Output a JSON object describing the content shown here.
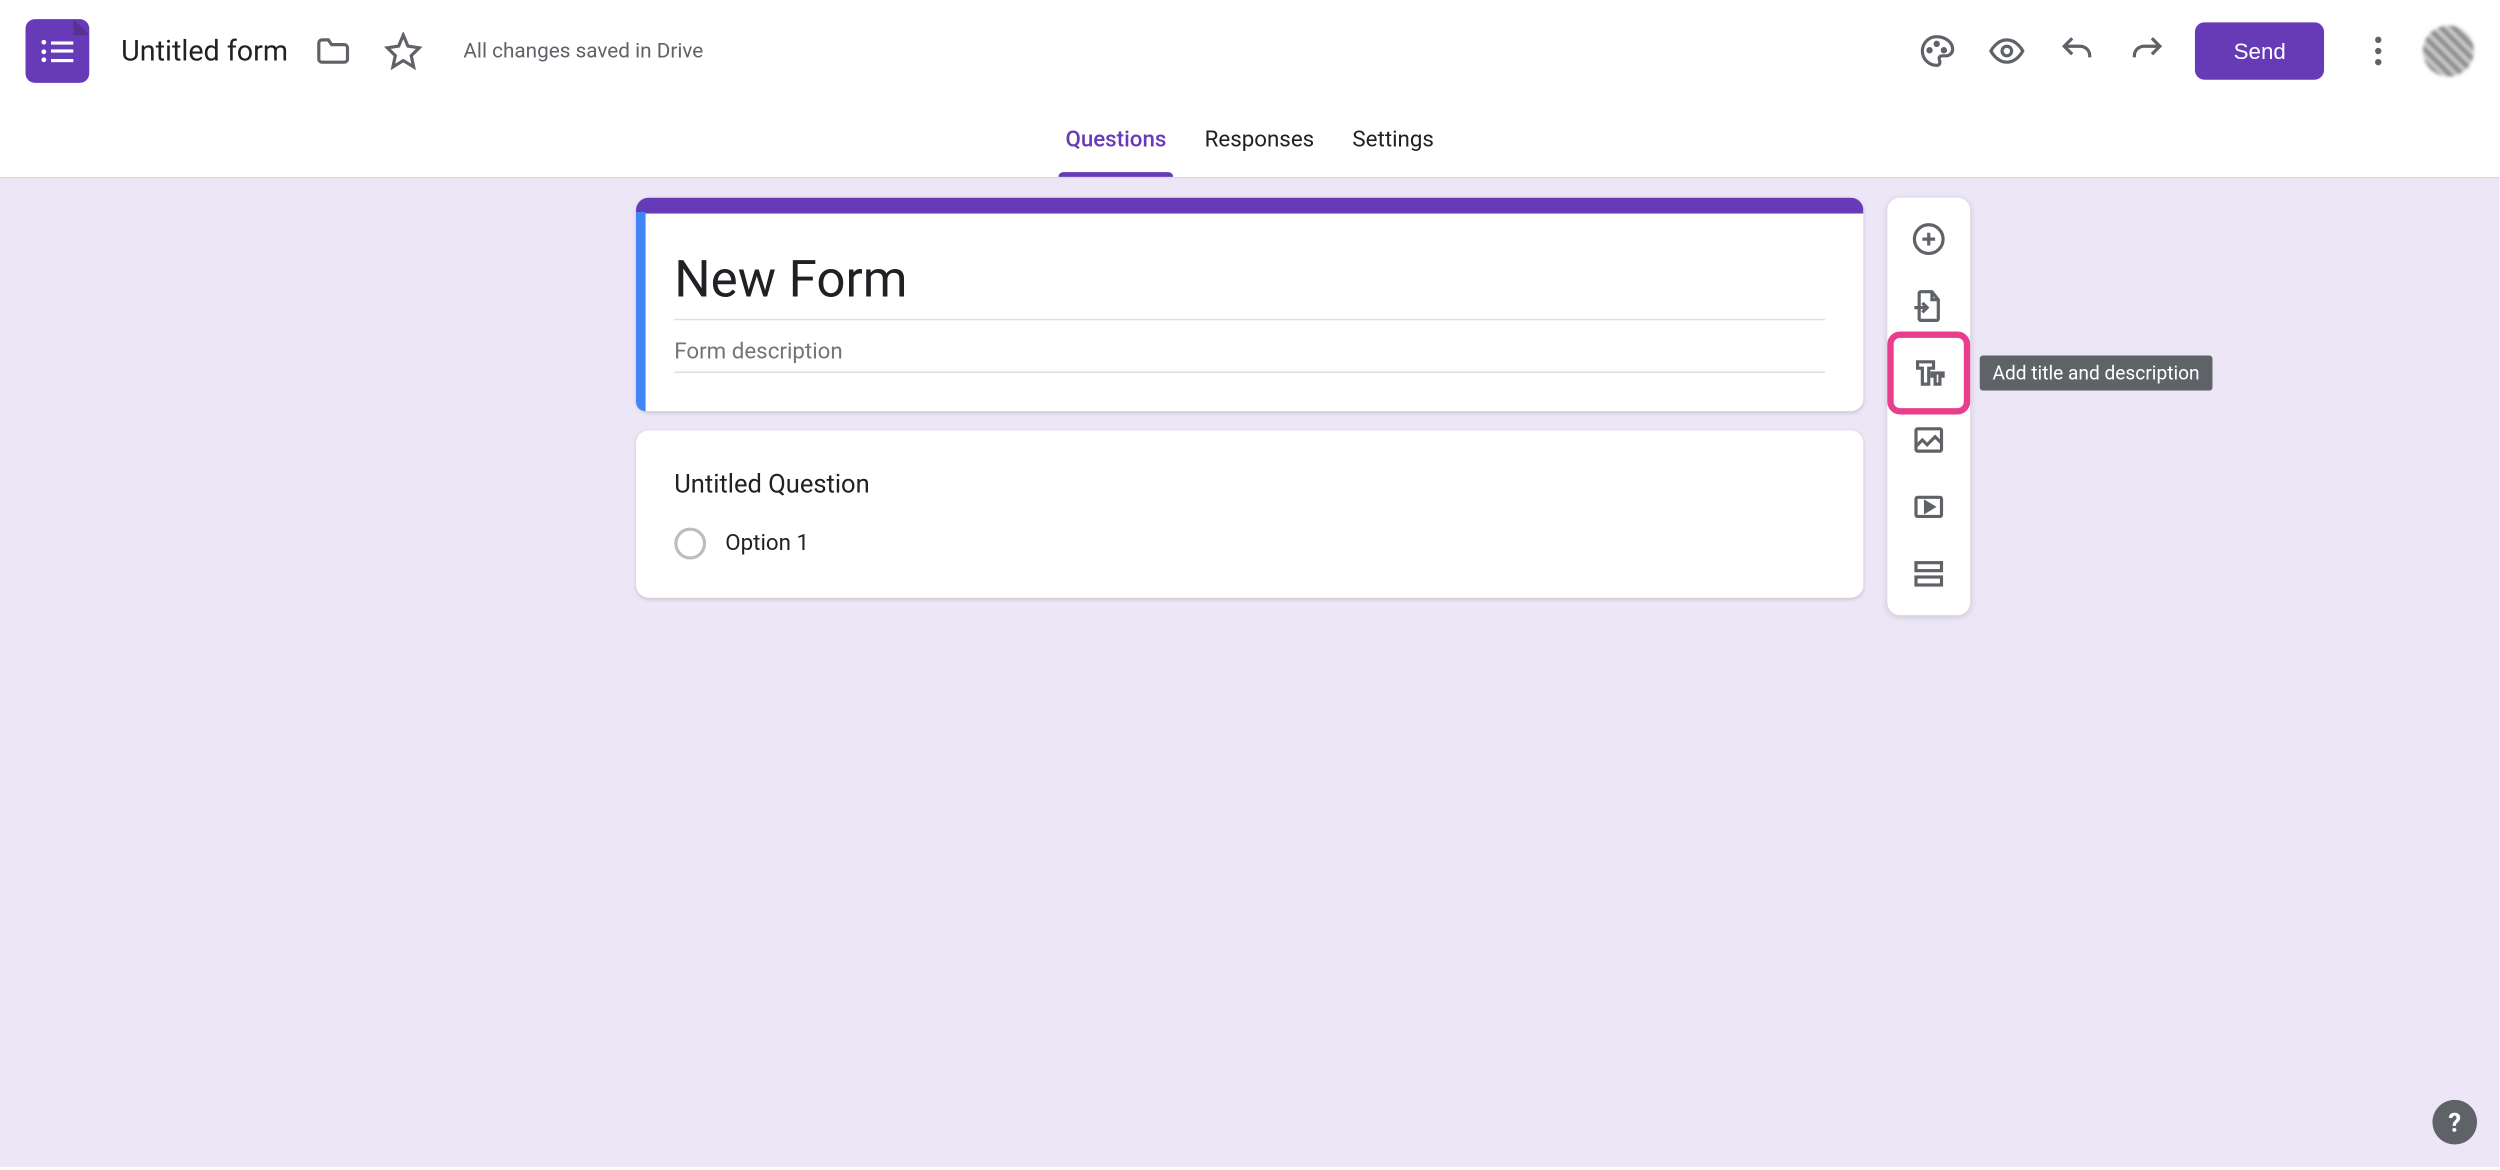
{
  "header": {
    "doc_title": "Untitled form",
    "save_status": "All changes saved in Drive",
    "send_label": "Send"
  },
  "tabs": {
    "questions": "Questions",
    "responses": "Responses",
    "settings": "Settings",
    "active": "questions"
  },
  "form": {
    "title": "New Form",
    "description_placeholder": "Form description",
    "description_value": ""
  },
  "question": {
    "title": "Untitled Question",
    "options": [
      "Option 1"
    ]
  },
  "side_toolbar": {
    "add_question": "Add question",
    "import_questions": "Import questions",
    "add_title": "Add title and description",
    "add_image": "Add image",
    "add_video": "Add video",
    "add_section": "Add section",
    "highlighted": "add_title",
    "tooltip_text": "Add title and description"
  },
  "icons": {
    "folder": "folder-icon",
    "star": "star-icon",
    "palette": "palette-icon",
    "preview": "eye-icon",
    "undo": "undo-icon",
    "redo": "redo-icon",
    "more": "more-vert-icon",
    "help": "?"
  }
}
